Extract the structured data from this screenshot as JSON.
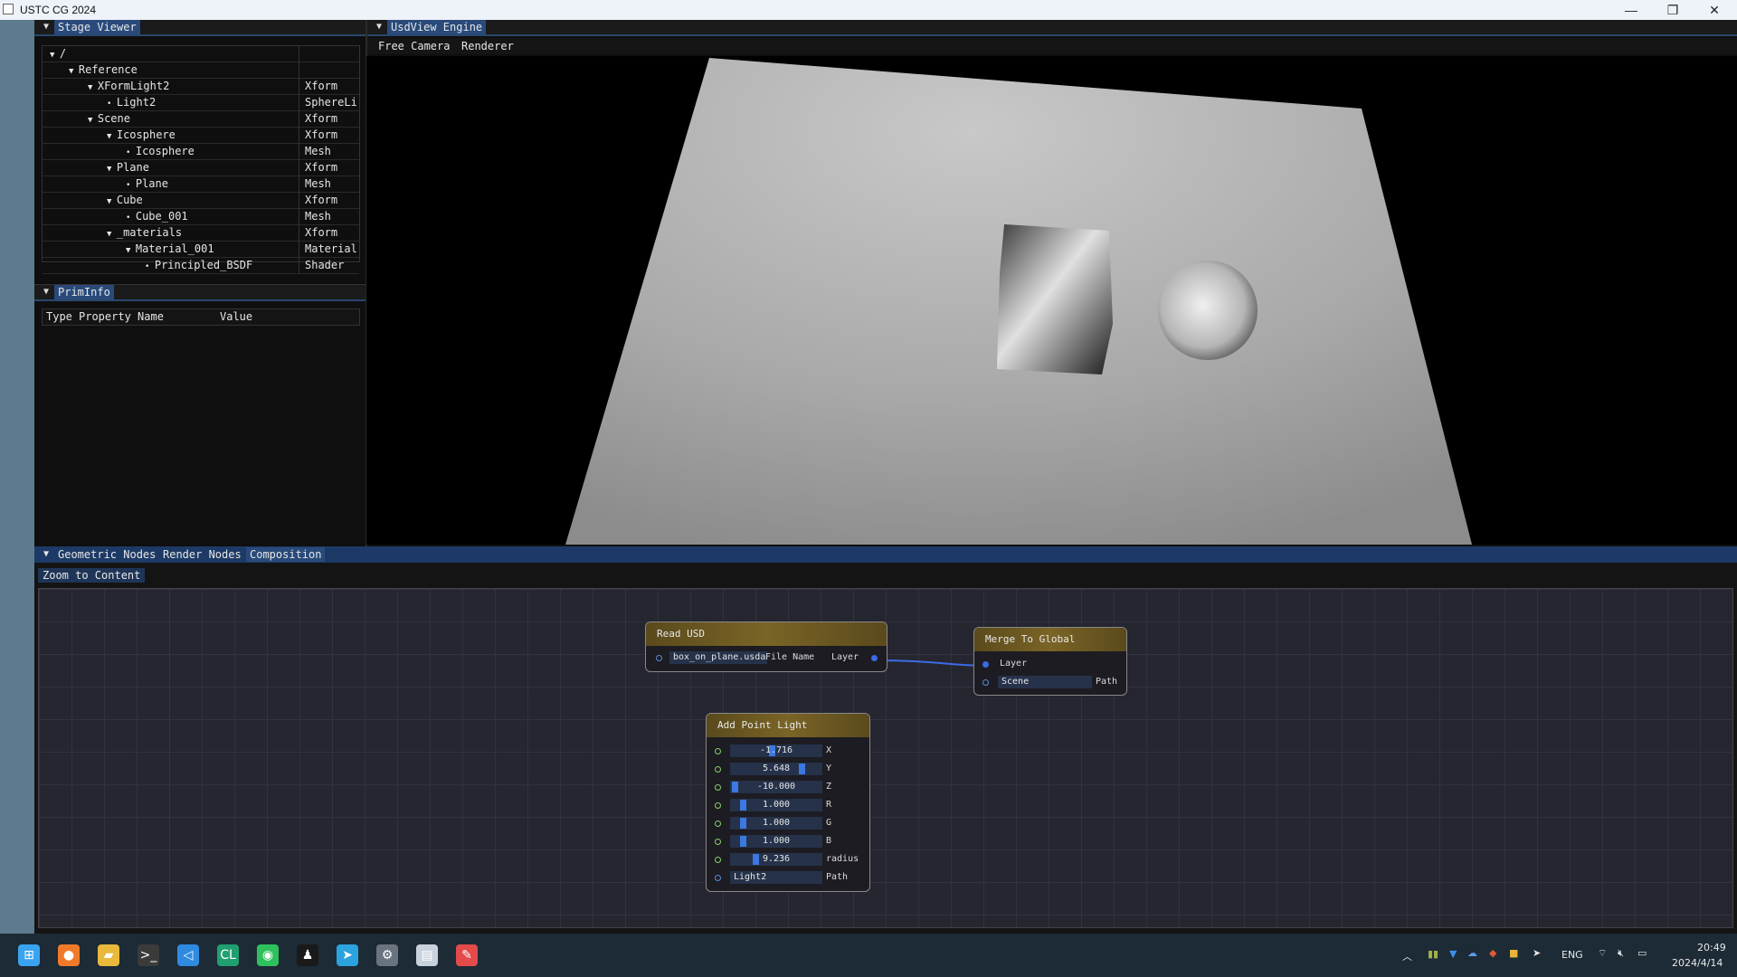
{
  "window": {
    "title": "USTC CG 2024",
    "minimize": "—",
    "maximize": "❐",
    "close": "✕"
  },
  "stage_viewer": {
    "tab": "Stage Viewer",
    "rows": [
      {
        "name": "/",
        "type": "",
        "depth": 0,
        "kind": "expand"
      },
      {
        "name": "Reference",
        "type": "",
        "depth": 1,
        "kind": "expand"
      },
      {
        "name": "XFormLight2",
        "type": "Xform",
        "depth": 2,
        "kind": "expand"
      },
      {
        "name": "Light2",
        "type": "SphereLic",
        "depth": 3,
        "kind": "leaf"
      },
      {
        "name": "Scene",
        "type": "Xform",
        "depth": 2,
        "kind": "expand"
      },
      {
        "name": "Icosphere",
        "type": "Xform",
        "depth": 3,
        "kind": "expand"
      },
      {
        "name": "Icosphere",
        "type": "Mesh",
        "depth": 4,
        "kind": "leaf"
      },
      {
        "name": "Plane",
        "type": "Xform",
        "depth": 3,
        "kind": "expand"
      },
      {
        "name": "Plane",
        "type": "Mesh",
        "depth": 4,
        "kind": "leaf"
      },
      {
        "name": "Cube",
        "type": "Xform",
        "depth": 3,
        "kind": "expand"
      },
      {
        "name": "Cube_001",
        "type": "Mesh",
        "depth": 4,
        "kind": "leaf"
      },
      {
        "name": "_materials",
        "type": "Xform",
        "depth": 3,
        "kind": "expand"
      },
      {
        "name": "Material_001",
        "type": "Material",
        "depth": 4,
        "kind": "expand"
      },
      {
        "name": "Principled_BSDF",
        "type": "Shader",
        "depth": 5,
        "kind": "leaf"
      }
    ]
  },
  "prim_info": {
    "tab": "PrimInfo",
    "col_type": "Type",
    "col_prop": "Property Name",
    "col_value": "Value"
  },
  "usdview": {
    "tab": "UsdView Engine",
    "menu_camera": "Free Camera",
    "menu_renderer": "Renderer"
  },
  "node_editor": {
    "tabs": [
      "Geometric Nodes",
      "Render Nodes",
      "Composition"
    ],
    "active_tab": 2,
    "zoom_button": "Zoom to Content",
    "read_usd": {
      "title": "Read USD",
      "file_value": "box_on_plane.usda",
      "file_label": "File Name",
      "output": "Layer"
    },
    "merge": {
      "title": "Merge To Global",
      "input_layer": "Layer",
      "scene_value": "Scene",
      "path_label": "Path"
    },
    "point_light": {
      "title": "Add Point Light",
      "fields": [
        {
          "value": "-1.716",
          "label": "X",
          "fraction": 0.45
        },
        {
          "value": "5.648",
          "label": "Y",
          "fraction": 0.82
        },
        {
          "value": "-10.000",
          "label": "Z",
          "fraction": 0.0
        },
        {
          "value": "1.000",
          "label": "R",
          "fraction": 0.1
        },
        {
          "value": "1.000",
          "label": "G",
          "fraction": 0.1
        },
        {
          "value": "1.000",
          "label": "B",
          "fraction": 0.1
        },
        {
          "value": "9.236",
          "label": "radius",
          "fraction": 0.25
        }
      ],
      "path_value": "Light2",
      "path_label": "Path"
    }
  },
  "taskbar": {
    "apps": [
      "start-icon",
      "firefox-icon",
      "file-explorer-icon",
      "terminal-icon",
      "vscode-icon",
      "clion-icon",
      "wechat-icon",
      "qq-icon",
      "telegram-icon",
      "settings-icon",
      "app-window-icon",
      "paint-icon"
    ],
    "lang": "ENG",
    "time": "20:49",
    "date": "2024/4/14"
  }
}
